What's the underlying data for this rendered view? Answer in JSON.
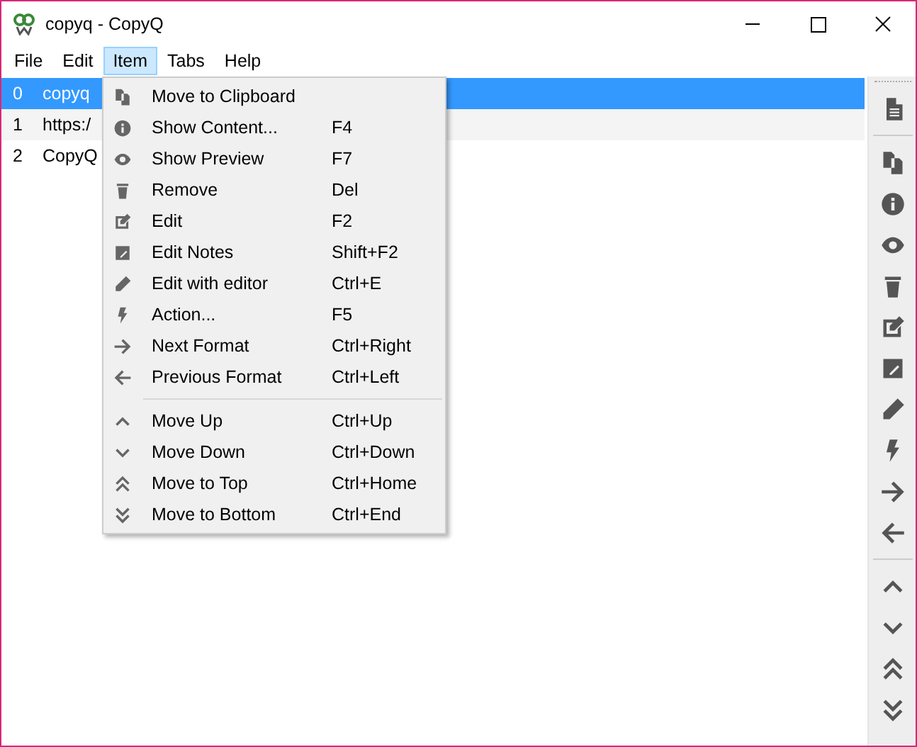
{
  "window": {
    "title": "copyq - CopyQ"
  },
  "menubar": [
    {
      "label": "File",
      "selected": false
    },
    {
      "label": "Edit",
      "selected": false
    },
    {
      "label": "Item",
      "selected": true
    },
    {
      "label": "Tabs",
      "selected": false
    },
    {
      "label": "Help",
      "selected": false
    }
  ],
  "rows": [
    {
      "index": "0",
      "text": "copyq",
      "selected": true
    },
    {
      "index": "1",
      "text": "https:/",
      "selected": false
    },
    {
      "index": "2",
      "text": "CopyQ",
      "selected": false
    }
  ],
  "menu": {
    "sections": [
      [
        {
          "label": "Move to Clipboard"
        },
        {
          "label": "Show Content...",
          "shortcut": "F4"
        },
        {
          "label": "Show Preview",
          "shortcut": "F7"
        },
        {
          "label": "Remove",
          "shortcut": "Del"
        },
        {
          "label": "Edit",
          "shortcut": "F2"
        },
        {
          "label": "Edit Notes",
          "shortcut": "Shift+F2"
        },
        {
          "label": "Edit with editor",
          "shortcut": "Ctrl+E"
        },
        {
          "label": "Action...",
          "shortcut": "F5"
        },
        {
          "label": "Next Format",
          "shortcut": "Ctrl+Right"
        },
        {
          "label": "Previous Format",
          "shortcut": "Ctrl+Left"
        }
      ],
      [
        {
          "label": "Move Up",
          "shortcut": "Ctrl+Up"
        },
        {
          "label": "Move Down",
          "shortcut": "Ctrl+Down"
        },
        {
          "label": "Move to Top",
          "shortcut": "Ctrl+Home"
        },
        {
          "label": "Move to Bottom",
          "shortcut": "Ctrl+End"
        }
      ]
    ]
  }
}
